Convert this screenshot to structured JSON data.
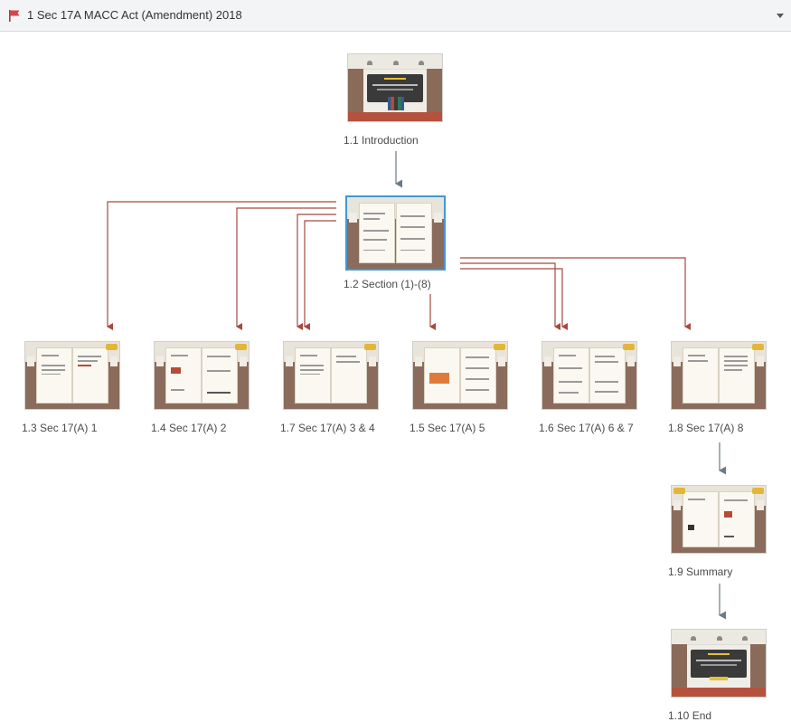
{
  "scene": {
    "title": "1 Sec 17A MACC Act (Amendment) 2018",
    "flag_icon": "flag-icon",
    "dropdown_icon": "chevron-down-icon",
    "colors": {
      "flag": "#d9434a",
      "link": "#a54a3f",
      "link_main": "#6b7a86",
      "selection": "#3f9bd1"
    }
  },
  "slides": [
    {
      "id": "s1_1",
      "label": "1.1 Introduction",
      "kind": "lib-intro"
    },
    {
      "id": "s1_2",
      "label": "1.2 Section (1)-(8)",
      "kind": "book-menu",
      "selected": true
    },
    {
      "id": "s1_3",
      "label": "1.3 Sec 17(A) 1",
      "kind": "book"
    },
    {
      "id": "s1_4",
      "label": "1.4 Sec 17(A) 2",
      "kind": "book"
    },
    {
      "id": "s1_7",
      "label": "1.7 Sec 17(A) 3 & 4",
      "kind": "book"
    },
    {
      "id": "s1_5",
      "label": "1.5 Sec 17(A) 5",
      "kind": "book"
    },
    {
      "id": "s1_6",
      "label": "1.6 Sec 17(A) 6 & 7",
      "kind": "book"
    },
    {
      "id": "s1_8",
      "label": "1.8 Sec 17(A) 8",
      "kind": "book"
    },
    {
      "id": "s1_9",
      "label": "1.9 Summary",
      "kind": "book"
    },
    {
      "id": "s1_10",
      "label": "1.10 End",
      "kind": "lib-end"
    }
  ]
}
